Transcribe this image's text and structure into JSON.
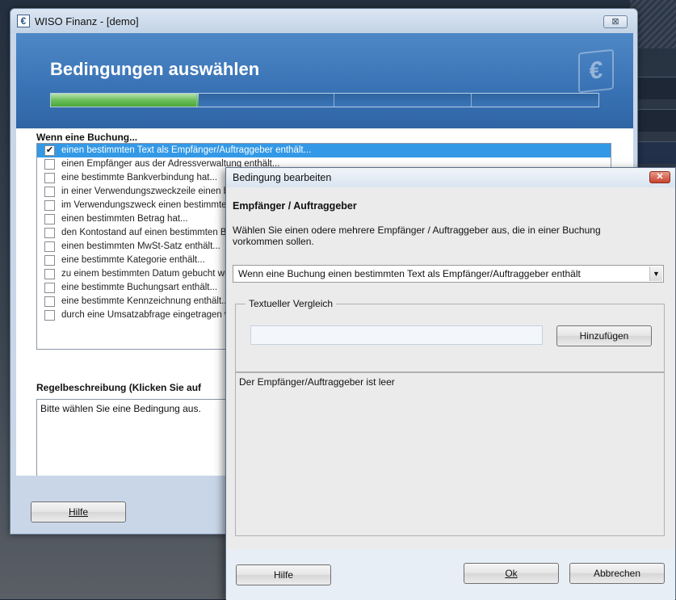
{
  "main_window": {
    "title": "WISO Finanz - [demo]",
    "close_label": "⊠",
    "heading": "Bedingungen auswählen",
    "logo_glyph": "€",
    "progress": 0.27,
    "section_conditions": "Wenn eine Buchung...",
    "conditions": [
      {
        "label": "einen bestimmten Text als Empfänger/Auftraggeber enthält...",
        "checked": true,
        "selected": true
      },
      {
        "label": "einen Empfänger aus der Adressverwaltung enthält...",
        "checked": false
      },
      {
        "label": "eine bestimmte Bankverbindung hat...",
        "checked": false
      },
      {
        "label": "in einer Verwendungszweckzeile einen bestimmten Text hat...",
        "checked": false
      },
      {
        "label": "im Verwendungszweck einen bestimmten Text enthält...",
        "checked": false
      },
      {
        "label": "einen bestimmten Betrag hat...",
        "checked": false
      },
      {
        "label": "den Kontostand auf einen bestimmten Betrag bringt...",
        "checked": false
      },
      {
        "label": "einen bestimmten MwSt-Satz enthält...",
        "checked": false
      },
      {
        "label": "eine bestimmte Kategorie enthält...",
        "checked": false
      },
      {
        "label": "zu einem bestimmten Datum gebucht wurde...",
        "checked": false
      },
      {
        "label": "eine bestimmte Buchungsart enthält...",
        "checked": false
      },
      {
        "label": "eine bestimmte Kennzeichnung enthält...",
        "checked": false
      },
      {
        "label": "durch eine Umsatzabfrage eingetragen wurde...",
        "checked": false
      }
    ],
    "section_description": "Regelbeschreibung (Klicken Sie auf",
    "description_text": "Bitte wählen Sie eine Bedingung aus.",
    "help_button": "Hilfe"
  },
  "dialog": {
    "title": "Bedingung bearbeiten",
    "close_label": "✕",
    "heading": "Empfänger / Auftraggeber",
    "instructions": "Wählen Sie einen odere mehrere Empfänger / Auftraggeber aus, die in einer Buchung vorkommen sollen.",
    "condition_select": "Wenn eine Buchung einen bestimmten Text als Empfänger/Auftraggeber enthält",
    "group_label": "Textueller Vergleich",
    "text_input_value": "",
    "add_button": "Hinzufügen",
    "list_message": "Der Empfänger/Auftraggeber ist leer",
    "help_button": "Hilfe",
    "ok_button": "Ok",
    "cancel_button": "Abbrechen"
  }
}
